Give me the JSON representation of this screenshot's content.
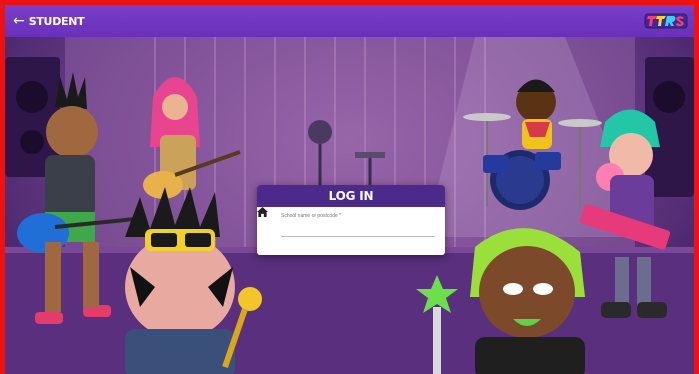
{
  "topbar": {
    "back_arrow": "←",
    "back_label": "STUDENT",
    "logo_icon": "ttrs-logo-icon",
    "color": "#6a30b8"
  },
  "login": {
    "title": "LOG IN",
    "field_label": "School name or postcode *",
    "field_value": "",
    "field_icon": "home-icon",
    "header_color": "#4b2a8c"
  },
  "background": {
    "scene": "rock-band-stage"
  },
  "frame_color": "#ee1111"
}
